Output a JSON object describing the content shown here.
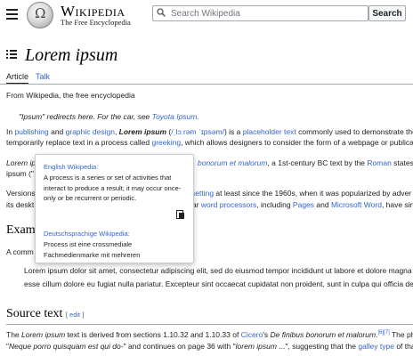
{
  "header": {
    "wordmark": "Wikipedia",
    "tagline": "The Free Encyclopedia",
    "search_placeholder": "Search Wikipedia",
    "search_button": "Search"
  },
  "article": {
    "title": "Lorem ipsum",
    "tabs": {
      "article": "Article",
      "talk": "Talk"
    },
    "from": "From Wikipedia, the free encyclopedia",
    "hatnote": {
      "pre": "\"Ipsum\" redirects here. For the car, see ",
      "link": "Toyota Ipsum",
      "post": "."
    },
    "para1": {
      "line1": {
        "t1": "In ",
        "l1": "publishing",
        "t2": " and ",
        "l2": "graphic design",
        "t3": ", ",
        "bi": "Lorem ipsum",
        "t4": " (",
        "ipa": "/ˌlɔːrəm ˈɪpsəm/",
        "t5": ") is a ",
        "l3": "placeholder text",
        "t6": " commonly used to demonstrate the"
      },
      "line2": {
        "t1": "temporarily replace text in a process called ",
        "l1": "greeking",
        "t2": ", which allows designers to consider the form of a webpage or publicati"
      }
    },
    "para2": {
      "line1": {
        "i1": "Lorem ip",
        "li": "bonorum et malorum",
        "t1": ", a 1st-century BC text by the ",
        "l1": "Roman",
        "t2": " statesm"
      },
      "line2": {
        "t1": "ipsum (\""
      }
    },
    "para3": {
      "line1": {
        "t1": "Versions",
        "l1": "setting",
        "t2": " at least since the 1960s, when it was popularized by adver"
      },
      "line2": {
        "t1": "its deskt",
        "t2": "ar ",
        "l1": "word processors",
        "t3": ", including ",
        "l2": "Pages",
        "t4": " and ",
        "l3": "Microsoft Word",
        "t5": ", have sinc"
      }
    },
    "example_heading": "Exam",
    "example_intro": "A comm",
    "example_quote": {
      "line1": "Lorem ipsum dolor sit amet, consectetur adipiscing elit, sed do eiusmod tempor incididunt ut labore et dolore magna a",
      "line2": "esse cillum dolore eu fugiat nulla pariatur. Excepteur sint occaecat cupidatat non proident, sunt in culpa qui officia des"
    },
    "source_heading": "Source text",
    "edit_label": "edit",
    "source_para": {
      "line1": {
        "t1": "The ",
        "i1": "Lorem ipsum",
        "t2": " text is derived from sections 1.10.32 and 1.10.33 of ",
        "l1": "Cicero",
        "t3": "'s ",
        "i2": "De finibus bonorum et malorum",
        "t4": ".",
        "sup": "[6][7]",
        "t5": " The ph"
      },
      "line2": {
        "t1": "\"",
        "i1": "Neque porro quisquam est qui do-",
        "t2": "\" and continues on page 36 with \"",
        "i2": "lorem ipsum",
        "t3": " ...\", suggesting that the ",
        "l1": "galley type",
        "t4": " of that"
      }
    }
  },
  "popup": {
    "en_heading": "English Wikipedia:",
    "en_text": "A process is a series or set of activities that interact to produce a result; it may occur once-only or be recurrent or periodic.",
    "de_heading": "Deutschsprachige Wikipedia:",
    "de_text": "Process ist eine crossmediale Fachmedienmarke mit mehreren"
  },
  "icons": [
    "menu-icon",
    "wikipedia-globe-logo",
    "search-icon",
    "toc-icon",
    "copy-icon"
  ],
  "colors": {
    "link": "#3366cc",
    "text": "#202122",
    "border": "#a2a9b1"
  }
}
